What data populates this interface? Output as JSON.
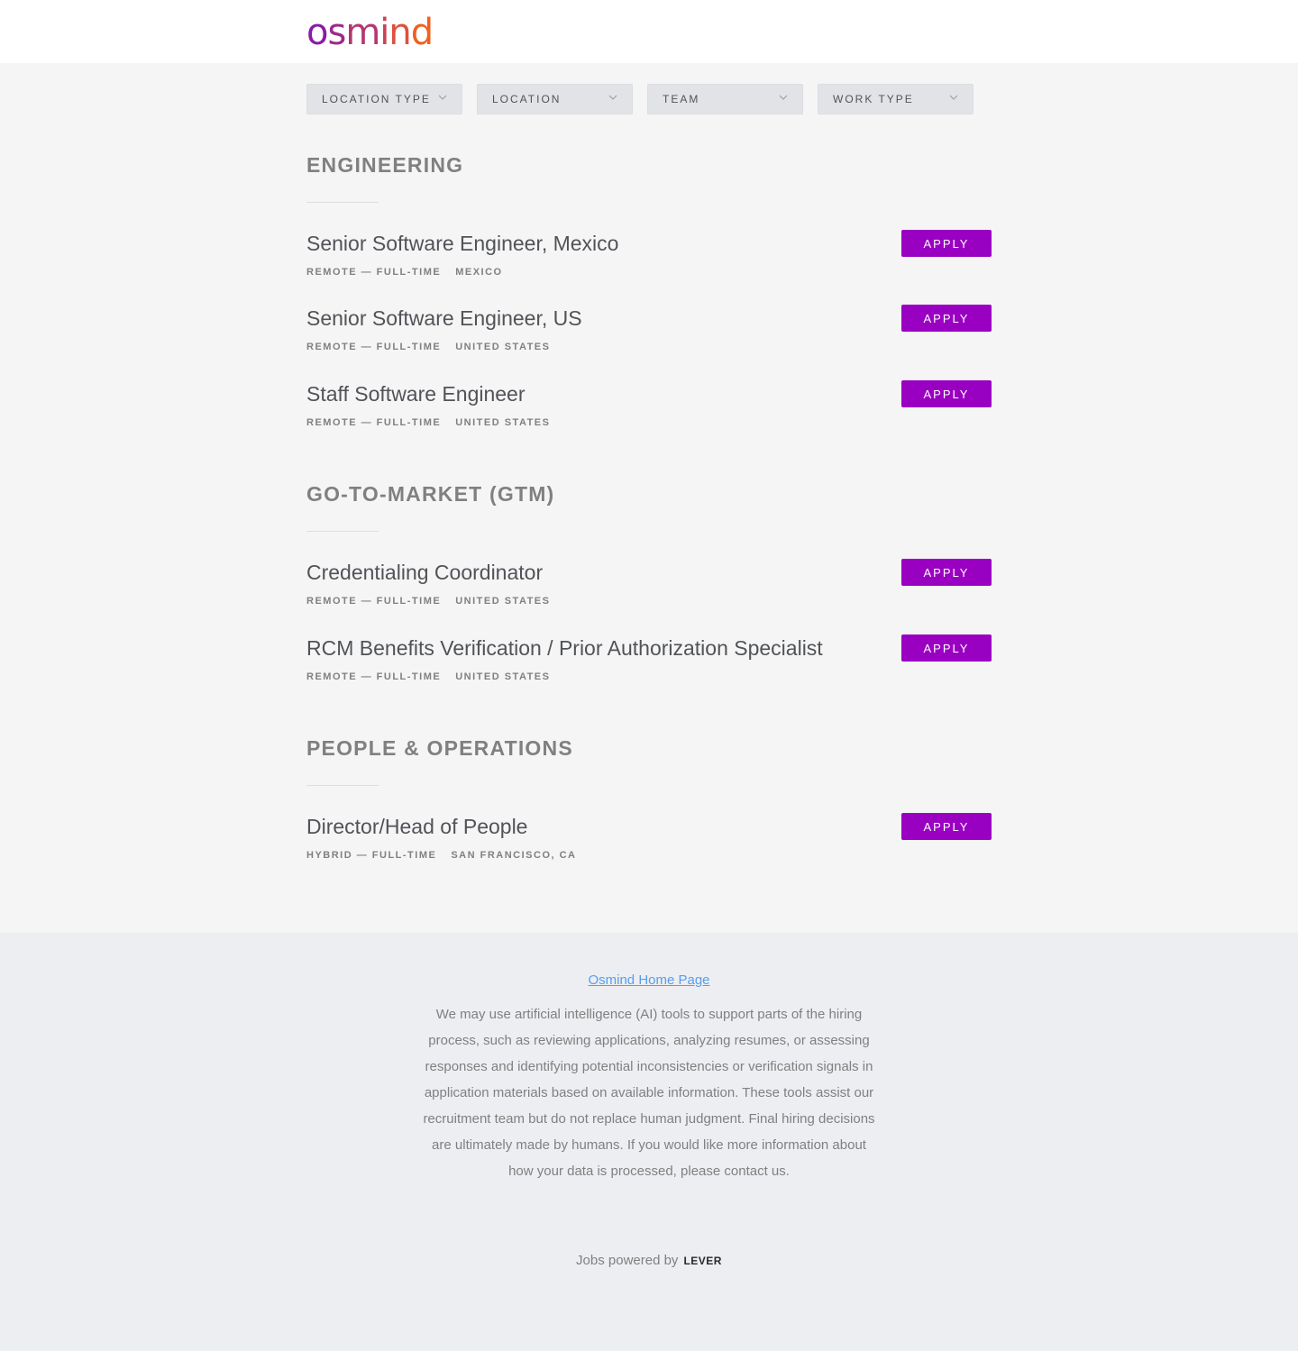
{
  "header": {
    "logo_text": "osmind"
  },
  "filters": [
    {
      "label": "LOCATION TYPE"
    },
    {
      "label": "LOCATION"
    },
    {
      "label": "TEAM"
    },
    {
      "label": "WORK TYPE"
    }
  ],
  "groups": [
    {
      "title": "ENGINEERING",
      "postings": [
        {
          "title": "Senior Software Engineer, Mexico",
          "commitment": "REMOTE — FULL-TIME",
          "location": "MEXICO",
          "apply_label": "APPLY"
        },
        {
          "title": "Senior Software Engineer, US",
          "commitment": "REMOTE — FULL-TIME",
          "location": "UNITED STATES",
          "apply_label": "APPLY"
        },
        {
          "title": "Staff Software Engineer",
          "commitment": "REMOTE — FULL-TIME",
          "location": "UNITED STATES",
          "apply_label": "APPLY"
        }
      ]
    },
    {
      "title": "GO-TO-MARKET (GTM)",
      "postings": [
        {
          "title": "Credentialing Coordinator",
          "commitment": "REMOTE — FULL-TIME",
          "location": "UNITED STATES",
          "apply_label": "APPLY"
        },
        {
          "title": "RCM Benefits Verification / Prior Authorization Specialist",
          "commitment": "REMOTE — FULL-TIME",
          "location": "UNITED STATES",
          "apply_label": "APPLY"
        }
      ]
    },
    {
      "title": "PEOPLE & OPERATIONS",
      "postings": [
        {
          "title": "Director/Head of People",
          "commitment": "HYBRID — FULL-TIME",
          "location": "SAN FRANCISCO, CA",
          "apply_label": "APPLY"
        }
      ]
    }
  ],
  "footer": {
    "home_link": "Osmind Home Page",
    "disclaimer": "We may use artificial intelligence (AI) tools to support parts of the hiring process, such as reviewing applications, analyzing resumes, or assessing responses and identifying potential inconsistencies or verification signals in application materials based on available information. These tools assist our recruitment team but do not replace human judgment. Final hiring decisions are ultimately made by humans. If you would like more information about how your data is processed, please contact us.",
    "powered_by": "Jobs powered by",
    "lever_brand": "LEVER"
  },
  "colors": {
    "apply_button": "#9a00c2",
    "link": "#579eee",
    "logo_gradient_start": "#8a1aa8",
    "logo_gradient_end": "#f06020"
  }
}
